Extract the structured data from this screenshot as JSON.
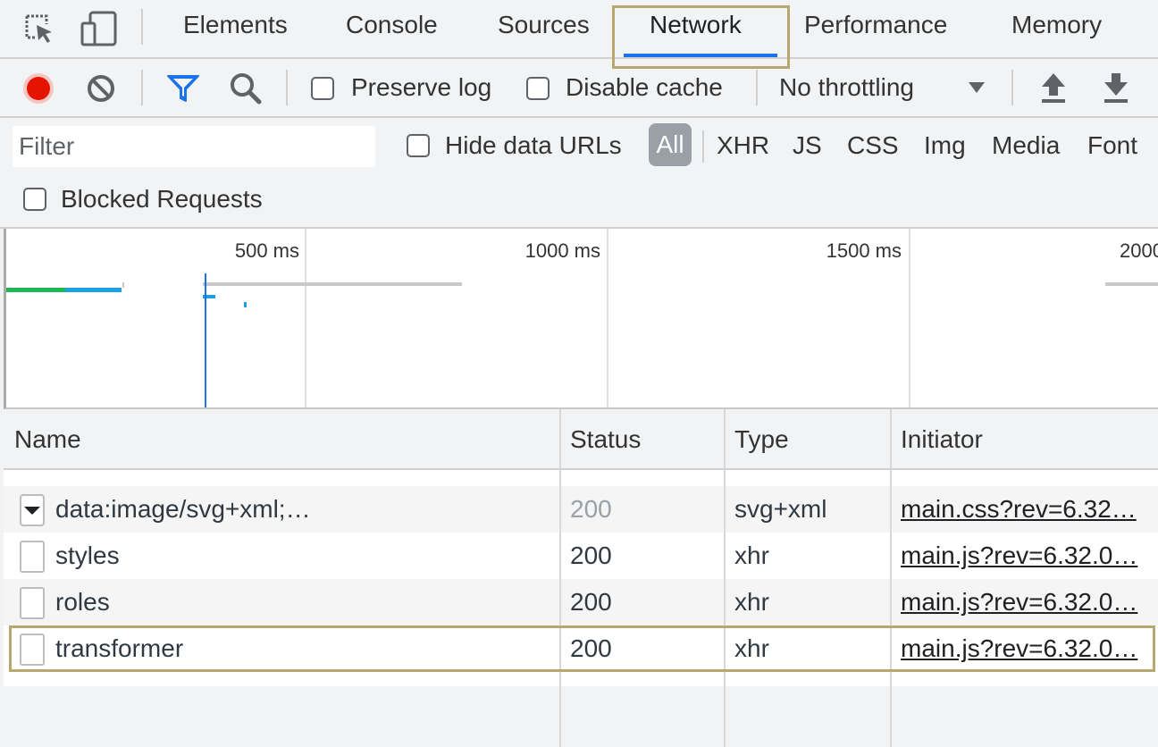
{
  "tabs": {
    "elements": "Elements",
    "console": "Console",
    "sources": "Sources",
    "network": "Network",
    "performance": "Performance",
    "memory": "Memory"
  },
  "toolbar": {
    "preserve_log": "Preserve log",
    "disable_cache": "Disable cache",
    "throttling": "No throttling",
    "record_color": "#e51400",
    "filter_icon_color": "#1a73e8"
  },
  "filter": {
    "placeholder": "Filter",
    "hide_data_urls": "Hide data URLs",
    "types": [
      "All",
      "XHR",
      "JS",
      "CSS",
      "Img",
      "Media",
      "Font"
    ],
    "blocked_requests": "Blocked Requests"
  },
  "overview": {
    "ticks": [
      "500 ms",
      "1000 ms",
      "1500 ms",
      "2000"
    ]
  },
  "table": {
    "headers": {
      "name": "Name",
      "status": "Status",
      "type": "Type",
      "initiator": "Initiator"
    },
    "rows": [
      {
        "name": "data:image/svg+xml;…",
        "status": "200",
        "type": "svg+xml",
        "initiator": "main.css?rev=6.32…"
      },
      {
        "name": "styles",
        "status": "200",
        "type": "xhr",
        "initiator": "main.js?rev=6.32.0…"
      },
      {
        "name": "roles",
        "status": "200",
        "type": "xhr",
        "initiator": "main.js?rev=6.32.0…"
      },
      {
        "name": "transformer",
        "status": "200",
        "type": "xhr",
        "initiator": "main.js?rev=6.32.0…"
      }
    ]
  }
}
